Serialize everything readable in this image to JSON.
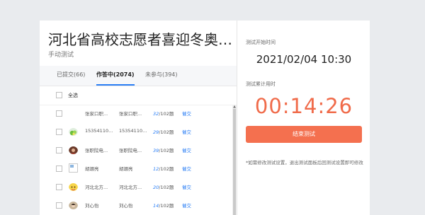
{
  "exam": {
    "title": "河北省高校志愿者喜迎冬奥会...",
    "subtitle": "手动测试"
  },
  "tabs": [
    {
      "label": "已提交(66)",
      "active": false
    },
    {
      "label": "作答中(2074)",
      "active": true
    },
    {
      "label": "未参与(394)",
      "active": false
    }
  ],
  "select_all_label": "全选",
  "students": [
    {
      "avatar": "none",
      "name": "张家口职...",
      "school": "张家口职...",
      "done": "32",
      "total": "/102题",
      "action": "催交"
    },
    {
      "avatar": "fruit",
      "name": "15354110...",
      "school": "15354110...",
      "done": "29",
      "total": "/102题",
      "action": "催交"
    },
    {
      "avatar": "photo",
      "name": "张职院电...",
      "school": "张职院电...",
      "done": "39",
      "total": "/102题",
      "action": "催交"
    },
    {
      "avatar": "broken",
      "name": "胡塬亮",
      "school": "胡塬亮",
      "done": "12",
      "total": "/102题",
      "action": "催交"
    },
    {
      "avatar": "sticker",
      "name": "河北北方...",
      "school": "河北北方...",
      "done": "20",
      "total": "/102题",
      "action": "催交"
    },
    {
      "avatar": "person",
      "name": "刘心怡",
      "school": "刘心怡",
      "done": "14",
      "total": "/102题",
      "action": "催交"
    }
  ],
  "right_panel": {
    "start_label": "测试开始时间",
    "start_time": "2021/02/04 10:30",
    "elapsed_label": "测试累计用时",
    "elapsed_time": "00:14:26",
    "end_button": "结束测试",
    "note": "*如需修改测试设置，退出测试面板后回测试设置即可修改"
  },
  "colors": {
    "accent_blue": "#2a7ef5",
    "timer_orange": "#f06b4a",
    "button_orange": "#f4704f",
    "background": "#e9ebee"
  }
}
